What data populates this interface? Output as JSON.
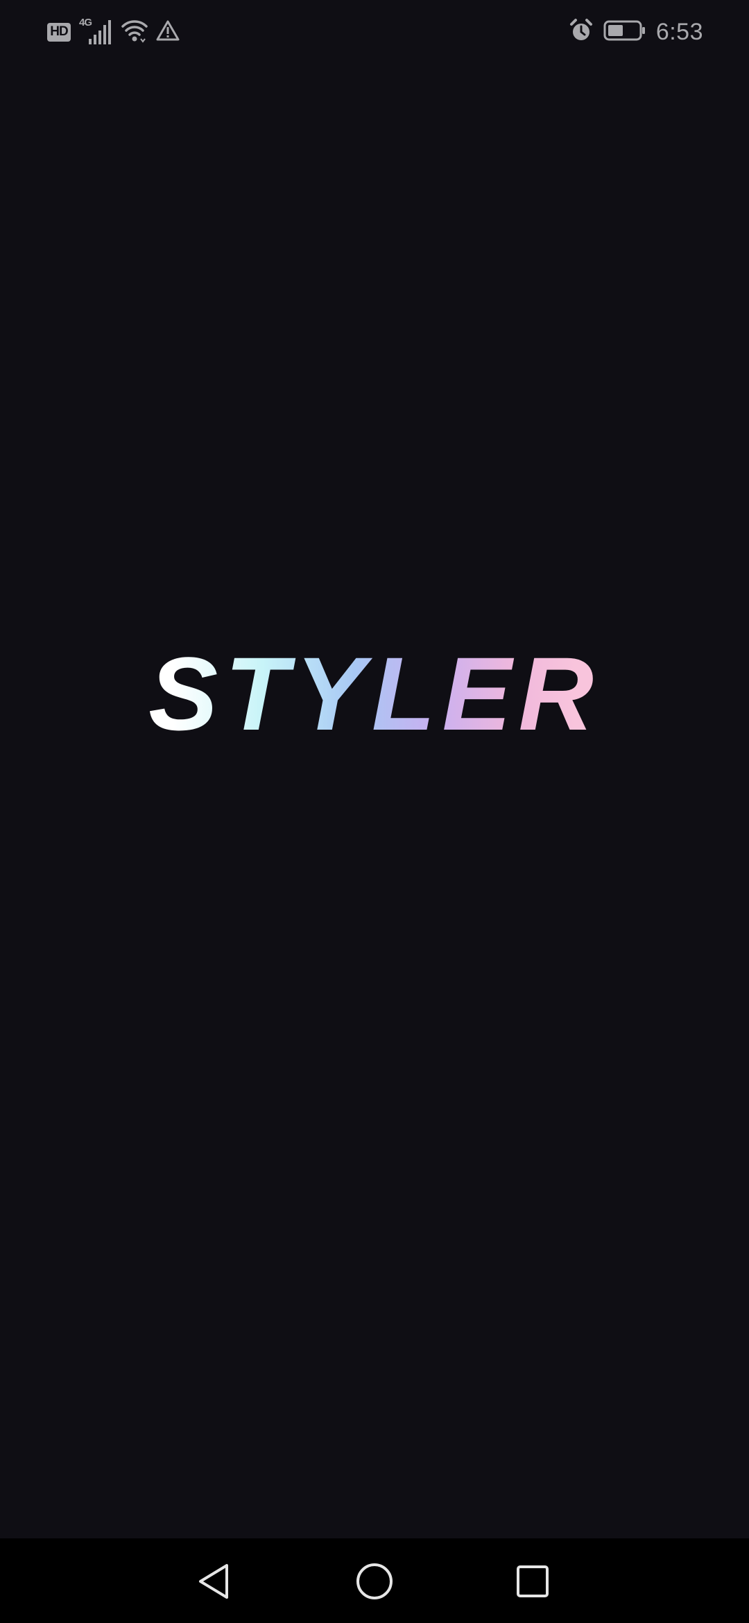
{
  "status_bar": {
    "hd_label": "HD",
    "network_type": "4G",
    "time": "6:53",
    "battery_level": 0.5,
    "icons": [
      "hd-icon",
      "signal-icon",
      "wifi-icon",
      "warning-icon",
      "alarm-icon",
      "battery-icon"
    ]
  },
  "splash": {
    "logo_text": "STYLER",
    "gradient_colors": [
      "#ffffff",
      "#c8f4f8",
      "#a8c8f4",
      "#c9b0f0",
      "#f0b8dc",
      "#f8c4dc"
    ]
  },
  "nav_bar": {
    "buttons": [
      "back-icon",
      "home-icon",
      "recents-icon"
    ]
  },
  "colors": {
    "background": "#0f0e14",
    "status_fg": "#a9a9ad",
    "nav_bg": "#000000"
  }
}
